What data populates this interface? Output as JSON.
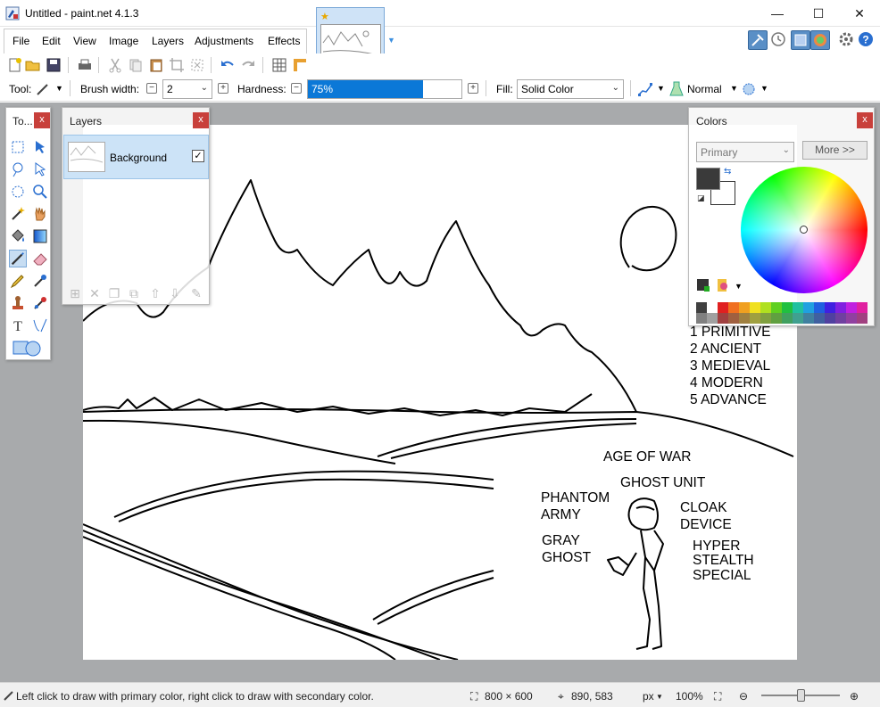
{
  "window": {
    "title": "Untitled - paint.net 4.1.3",
    "minimize_glyph": "—",
    "maximize_glyph": "☐",
    "close_glyph": "✕"
  },
  "menu": {
    "items": [
      "File",
      "Edit",
      "View",
      "Image",
      "Layers",
      "Adjustments",
      "Effects"
    ]
  },
  "options": {
    "tool_label": "Tool:",
    "brush_width_label": "Brush width:",
    "brush_width_value": "2",
    "hardness_label": "Hardness:",
    "hardness_value": "75%",
    "hardness_fraction": 0.75,
    "fill_label": "Fill:",
    "fill_value": "Solid Color",
    "blend_mode": "Normal"
  },
  "tools_panel": {
    "title": "To...",
    "close": "x"
  },
  "layers_panel": {
    "title": "Layers",
    "close": "x",
    "layers": [
      {
        "name": "Background",
        "visible_glyph": "✓"
      }
    ]
  },
  "colors_panel": {
    "title": "Colors",
    "close": "x",
    "mode": "Primary",
    "more_button": "More >>",
    "primary_color": "#3a3a3a",
    "secondary_color": "#ffffff",
    "palette_row1": [
      "#404040",
      "#ffffff",
      "#e02020",
      "#f07020",
      "#f0a020",
      "#f0e020",
      "#b0e020",
      "#60d020",
      "#20c040",
      "#20c0a0",
      "#20a0e0",
      "#2060e0",
      "#4020e0",
      "#8020e0",
      "#c020e0",
      "#e020a0"
    ],
    "palette_row2": [
      "#808080",
      "#a0a0a0",
      "#a04040",
      "#a06040",
      "#a08040",
      "#a0a040",
      "#80a040",
      "#60a040",
      "#40a060",
      "#40a090",
      "#4080a0",
      "#4060a0",
      "#5040a0",
      "#7040a0",
      "#9040a0",
      "#a04080"
    ]
  },
  "canvas_text": {
    "list": [
      "1 PRIMITIVE",
      "2 ANCIENT",
      "3 MEDIEVAL",
      "4 MODERN",
      "5 ADVANCE"
    ],
    "age_of_war": "AGE OF WAR",
    "ghost_unit": "GHOST UNIT",
    "phantom": [
      "PHANTOM",
      "ARMY"
    ],
    "gray": [
      "GRAY",
      "GHOST"
    ],
    "cloak": [
      "CLOAK",
      "DEVICE"
    ],
    "hyper": [
      "HYPER",
      "STEALTH",
      "SPECIAL"
    ]
  },
  "status": {
    "hint": "Left click to draw with primary color, right click to draw with secondary color.",
    "image_size": "800 × 600",
    "cursor_pos": "890, 583",
    "units": "px",
    "zoom": "100%"
  }
}
